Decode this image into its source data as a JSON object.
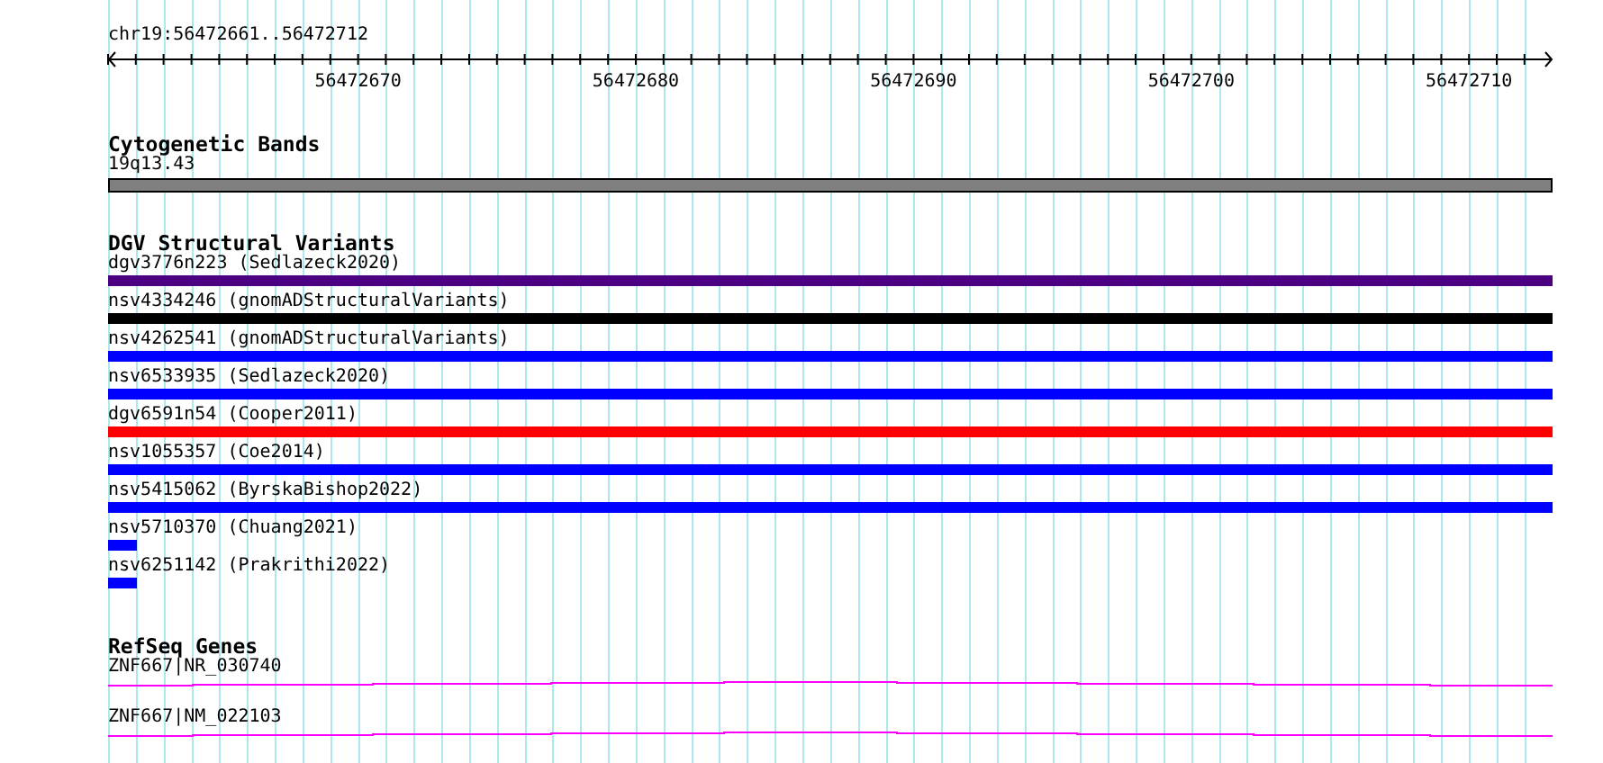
{
  "location": "chr19:56472661..56472712",
  "ruler": {
    "tick_labels": [
      "56472670",
      "56472680",
      "56472690",
      "56472700",
      "56472710"
    ]
  },
  "tracks": [
    {
      "title": "Cytogenetic Bands",
      "features": [
        {
          "label": "19q13.43",
          "kind": "band",
          "color": "#808080"
        }
      ]
    },
    {
      "title": "DGV Structural Variants",
      "features": [
        {
          "label": "dgv3776n223 (Sedlazeck2020)",
          "kind": "full",
          "color": "#4b0082"
        },
        {
          "label": "nsv4334246 (gnomADStructuralVariants)",
          "kind": "full",
          "color": "#000000"
        },
        {
          "label": "nsv4262541 (gnomADStructuralVariants)",
          "kind": "full",
          "color": "#0000ff"
        },
        {
          "label": "nsv6533935 (Sedlazeck2020)",
          "kind": "full",
          "color": "#0000ff"
        },
        {
          "label": "dgv6591n54 (Cooper2011)",
          "kind": "full",
          "color": "#ff0000"
        },
        {
          "label": "nsv1055357 (Coe2014)",
          "kind": "full",
          "color": "#0000ff"
        },
        {
          "label": "nsv5415062 (ByrskaBishop2022)",
          "kind": "full",
          "color": "#0000ff"
        },
        {
          "label": "nsv5710370 (Chuang2021)",
          "kind": "short",
          "color": "#0000ff"
        },
        {
          "label": "nsv6251142 (Prakrithi2022)",
          "kind": "short",
          "color": "#0000ff"
        }
      ]
    },
    {
      "title": "RefSeq Genes",
      "features": [
        {
          "label": "ZNF667|NR_030740",
          "kind": "transcript",
          "color": "#ff00ff"
        },
        {
          "label": "ZNF667|NM_022103",
          "kind": "transcript",
          "color": "#ff00ff"
        }
      ]
    }
  ]
}
